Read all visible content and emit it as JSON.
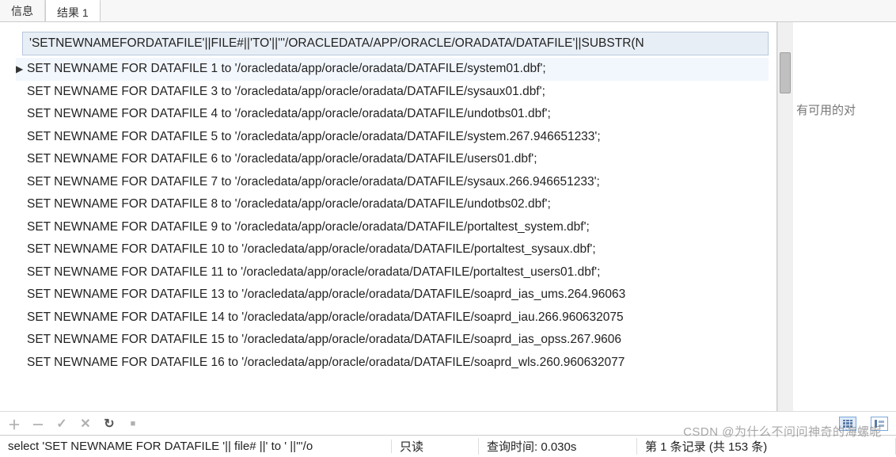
{
  "tabs": {
    "info": "信息",
    "result": "结果 1"
  },
  "column_header": "'SETNEWNAMEFORDATAFILE'||FILE#||'TO'||'''/ORACLEDATA/APP/ORACLE/ORADATA/DATAFILE'||SUBSTR(N",
  "rows": [
    "SET NEWNAME FOR DATAFILE 1 to '/oracledata/app/oracle/oradata/DATAFILE/system01.dbf';",
    "SET NEWNAME FOR DATAFILE 3 to '/oracledata/app/oracle/oradata/DATAFILE/sysaux01.dbf';",
    "SET NEWNAME FOR DATAFILE 4 to '/oracledata/app/oracle/oradata/DATAFILE/undotbs01.dbf';",
    "SET NEWNAME FOR DATAFILE 5 to '/oracledata/app/oracle/oradata/DATAFILE/system.267.946651233';",
    "SET NEWNAME FOR DATAFILE 6 to '/oracledata/app/oracle/oradata/DATAFILE/users01.dbf';",
    "SET NEWNAME FOR DATAFILE 7 to '/oracledata/app/oracle/oradata/DATAFILE/sysaux.266.946651233';",
    "SET NEWNAME FOR DATAFILE 8 to '/oracledata/app/oracle/oradata/DATAFILE/undotbs02.dbf';",
    "SET NEWNAME FOR DATAFILE 9 to '/oracledata/app/oracle/oradata/DATAFILE/portaltest_system.dbf';",
    "SET NEWNAME FOR DATAFILE 10 to '/oracledata/app/oracle/oradata/DATAFILE/portaltest_sysaux.dbf';",
    "SET NEWNAME FOR DATAFILE 11 to '/oracledata/app/oracle/oradata/DATAFILE/portaltest_users01.dbf';",
    "SET NEWNAME FOR DATAFILE 13 to '/oracledata/app/oracle/oradata/DATAFILE/soaprd_ias_ums.264.96063",
    "SET NEWNAME FOR DATAFILE 14 to '/oracledata/app/oracle/oradata/DATAFILE/soaprd_iau.266.960632075",
    "SET NEWNAME FOR DATAFILE 15 to '/oracledata/app/oracle/oradata/DATAFILE/soaprd_ias_opss.267.9606",
    "SET NEWNAME FOR DATAFILE 16 to '/oracledata/app/oracle/oradata/DATAFILE/soaprd_wls.260.960632077"
  ],
  "current_row_index": 0,
  "side_text": "有可用的对",
  "toolbar": {
    "add": "＋",
    "remove": "－",
    "check": "✓",
    "cancel": "✕",
    "refresh": "↻",
    "stop": "■"
  },
  "statusbar": {
    "sql": "select 'SET NEWNAME FOR DATAFILE '|| file# ||' to ' ||'''/o",
    "readonly": "只读",
    "query_time": "查询时间: 0.030s",
    "record": "第 1 条记录 (共 153 条)"
  },
  "watermark": "CSDN @为什么不问问神奇的海螺呢"
}
